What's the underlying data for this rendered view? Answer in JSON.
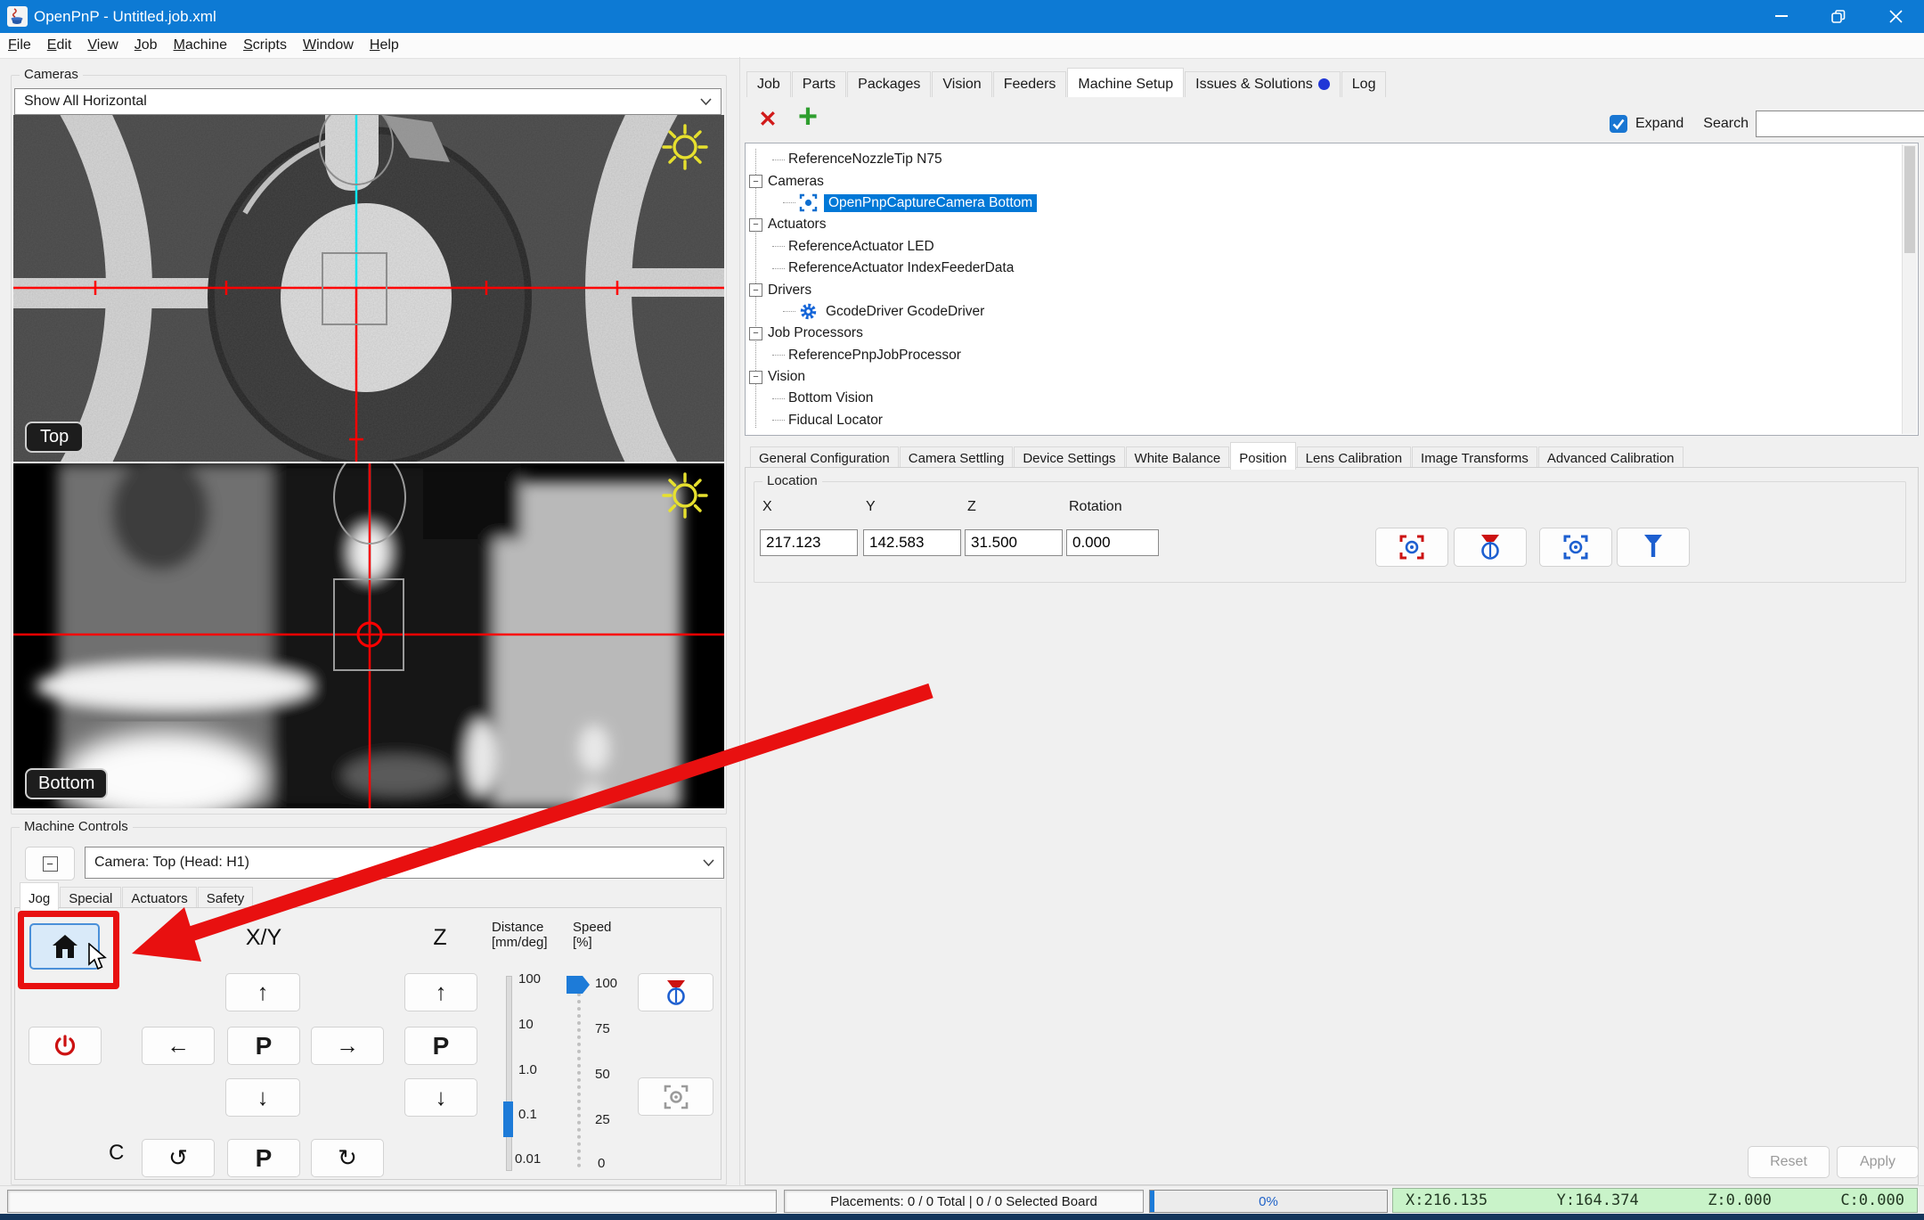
{
  "window": {
    "title": "OpenPnP - Untitled.job.xml"
  },
  "menu": {
    "items": [
      {
        "mnemonic": "F",
        "rest": "ile"
      },
      {
        "mnemonic": "E",
        "rest": "dit"
      },
      {
        "mnemonic": "V",
        "rest": "iew"
      },
      {
        "mnemonic": "J",
        "rest": "ob"
      },
      {
        "mnemonic": "M",
        "rest": "achine"
      },
      {
        "mnemonic": "S",
        "rest": "cripts"
      },
      {
        "mnemonic": "W",
        "rest": "indow"
      },
      {
        "mnemonic": "H",
        "rest": "elp"
      }
    ]
  },
  "cameras_panel": {
    "title": "Cameras",
    "view_mode": "Show All Horizontal",
    "top_label": "Top",
    "bottom_label": "Bottom"
  },
  "machine_controls": {
    "title": "Machine Controls",
    "collapse_glyph": "−",
    "selector": "Camera: Top (Head: H1)",
    "tabs": [
      "Jog",
      "Special",
      "Actuators",
      "Safety"
    ],
    "selected_tab": "Jog",
    "jog": {
      "xy_header": "X/Y",
      "z_header": "Z",
      "distance_header_line1": "Distance",
      "distance_header_line2": "[mm/deg]",
      "speed_header_line1": "Speed",
      "speed_header_line2": "[%]",
      "up": "↑",
      "down": "↓",
      "left": "←",
      "right": "→",
      "ccw": "↺",
      "cw": "↻",
      "p_label": "P",
      "c_label": "C",
      "distance_ticks": [
        "100",
        "10",
        "1.0",
        "0.1",
        "0.01"
      ],
      "distance_value": "0.1",
      "speed_ticks": [
        "100",
        "75",
        "50",
        "25",
        "0"
      ],
      "speed_value": "100"
    }
  },
  "right_panel": {
    "tabs": [
      "Job",
      "Parts",
      "Packages",
      "Vision",
      "Feeders",
      "Machine Setup",
      "Issues & Solutions",
      "Log"
    ],
    "selected_tab": "Machine Setup",
    "toolbar": {
      "delete_glyph": "✕",
      "add_glyph": "+",
      "expand_label": "Expand",
      "expand_checked": true,
      "search_label": "Search",
      "search_value": ""
    },
    "tree": {
      "items": [
        {
          "label": "ReferenceNozzleTip N75"
        },
        {
          "label": "Cameras"
        },
        {
          "label": "OpenPnpCaptureCamera Bottom",
          "selected": true,
          "icon": "camera"
        },
        {
          "label": "Actuators"
        },
        {
          "label": "ReferenceActuator LED"
        },
        {
          "label": "ReferenceActuator IndexFeederData"
        },
        {
          "label": "Drivers"
        },
        {
          "label": "GcodeDriver GcodeDriver",
          "icon": "gear"
        },
        {
          "label": "Job Processors"
        },
        {
          "label": "ReferencePnpJobProcessor"
        },
        {
          "label": "Vision"
        },
        {
          "label": "Bottom Vision"
        },
        {
          "label": "Fiducal Locator"
        }
      ]
    },
    "config_tabs": [
      "General Configuration",
      "Camera Settling",
      "Device Settings",
      "White Balance",
      "Position",
      "Lens Calibration",
      "Image Transforms",
      "Advanced Calibration"
    ],
    "selected_config_tab": "Position",
    "location": {
      "title": "Location",
      "fields": [
        {
          "label": "X",
          "value": "217.123"
        },
        {
          "label": "Y",
          "value": "142.583"
        },
        {
          "label": "Z",
          "value": "31.500"
        },
        {
          "label": "Rotation",
          "value": "0.000"
        }
      ]
    },
    "actions": {
      "reset_label": "Reset",
      "apply_label": "Apply"
    }
  },
  "status_bar": {
    "placements": "Placements: 0 / 0 Total | 0 / 0 Selected Board",
    "progress": "0%",
    "coords": {
      "x": "X:216.135",
      "y": "Y:164.374",
      "z": "Z:0.000",
      "c": "C:0.000"
    }
  },
  "colors": {
    "titlebar": "#0d7ad4",
    "selection": "#0078d7",
    "annotation": "#e81010",
    "coords_bg": "#c9f3c9",
    "reticle_red": "#ff0000",
    "reticle_cyan": "#0ce6f2",
    "sun_yellow": "#e6e02e"
  }
}
